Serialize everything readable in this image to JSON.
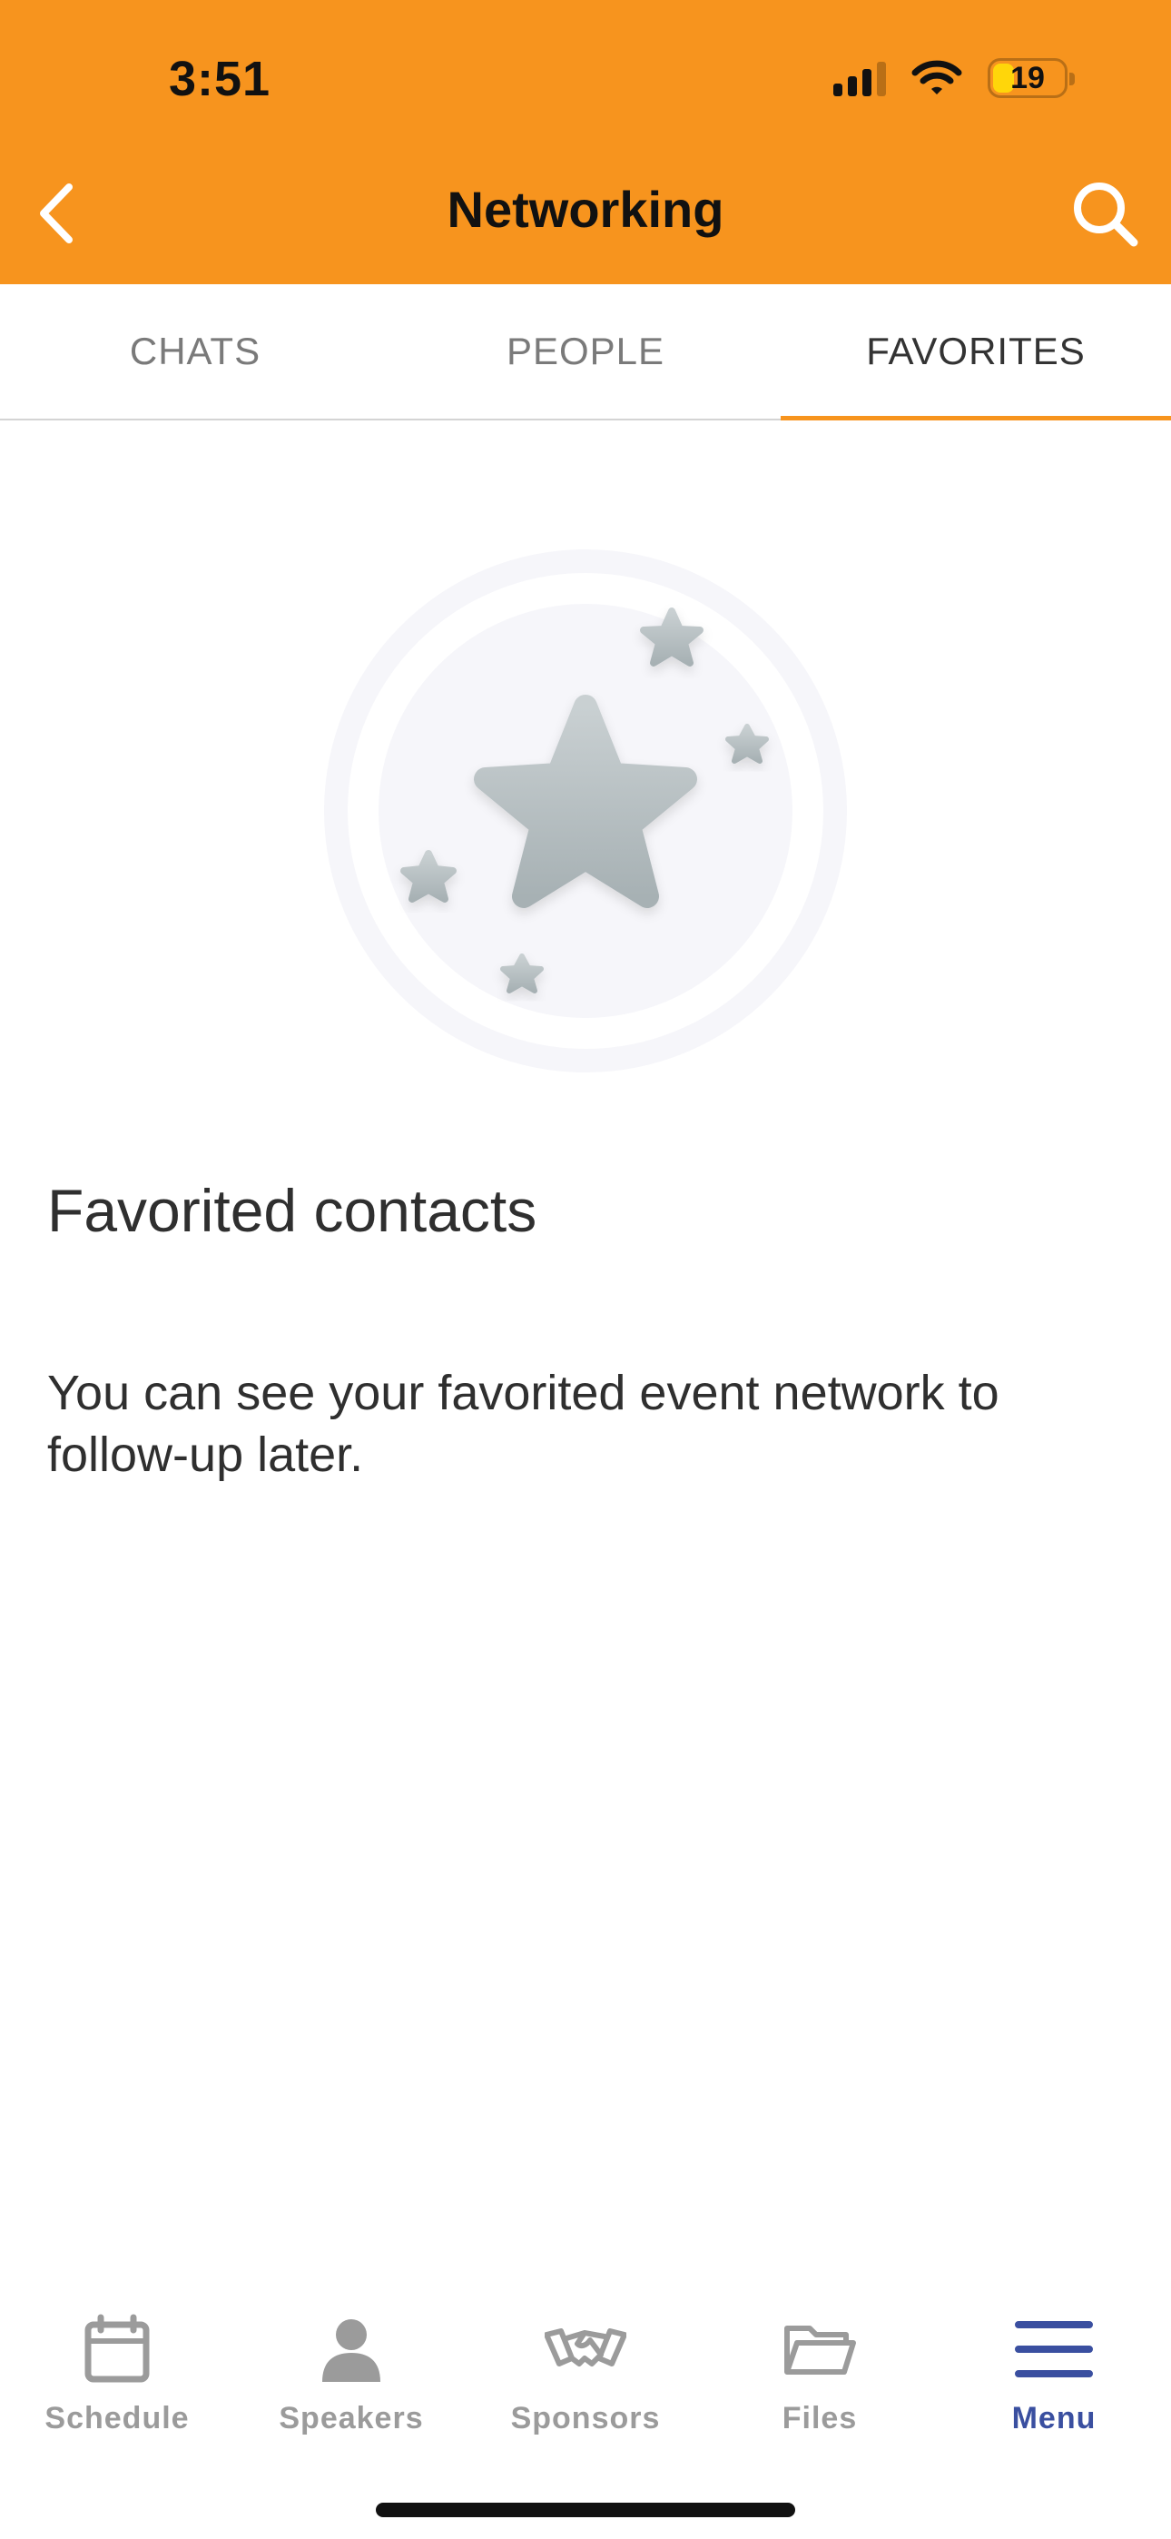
{
  "status_bar": {
    "time": "3:51",
    "battery_level": "19",
    "battery_fraction": 0.19
  },
  "header": {
    "title": "Networking",
    "back_icon": "chevron-left-icon",
    "search_icon": "search-icon",
    "background_color": "#F7941E"
  },
  "tabs": [
    {
      "label": "CHATS",
      "active": false
    },
    {
      "label": "PEOPLE",
      "active": false
    },
    {
      "label": "FAVORITES",
      "active": true
    }
  ],
  "empty_state": {
    "illustration_icon": "stars-icon",
    "title": "Favorited contacts",
    "description": "You can see your favorited event network to follow-up later."
  },
  "bottom_nav": {
    "items": [
      {
        "label": "Schedule",
        "icon": "calendar-icon",
        "active": false
      },
      {
        "label": "Speakers",
        "icon": "person-icon",
        "active": false
      },
      {
        "label": "Sponsors",
        "icon": "handshake-icon",
        "active": false
      },
      {
        "label": "Files",
        "icon": "folder-icon",
        "active": false
      },
      {
        "label": "Menu",
        "icon": "menu-icon",
        "active": true
      }
    ],
    "active_color": "#3A4FA0",
    "inactive_color": "#9B9B9B"
  }
}
